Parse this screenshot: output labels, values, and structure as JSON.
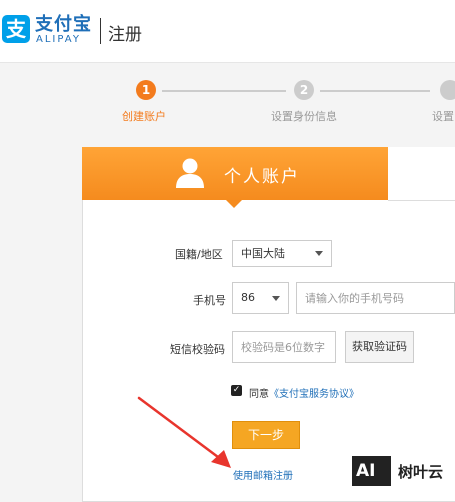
{
  "header": {
    "logo_glyph": "支",
    "logo_cn": "支付宝",
    "logo_en": "ALIPAY",
    "title": "注册"
  },
  "steps": [
    {
      "number": "1",
      "label": "创建账户",
      "active": true
    },
    {
      "number": "2",
      "label": "设置身份信息",
      "active": false
    },
    {
      "number": "",
      "label": "设置",
      "active": false
    }
  ],
  "tabs": {
    "personal_label": "个人账户"
  },
  "form": {
    "nationality_label": "国籍/地区",
    "nationality_value": "中国大陆",
    "phone_label": "手机号",
    "country_code": "86",
    "phone_placeholder": "请输入你的手机号码",
    "sms_label": "短信校验码",
    "sms_placeholder": "校验码是6位数字",
    "get_code_button": "获取验证码",
    "agree_prefix": "同意",
    "agree_link": "《支付宝服务协议》",
    "agree_checked": true,
    "next_button": "下一步",
    "email_register_link": "使用邮箱注册"
  },
  "watermark": {
    "badge": "AI",
    "text": "树叶云"
  },
  "colors": {
    "accent_orange": "#f58b1e",
    "brand_blue": "#00a0e9",
    "link_blue": "#1f6fb8",
    "annotation_red": "#e8352d"
  }
}
